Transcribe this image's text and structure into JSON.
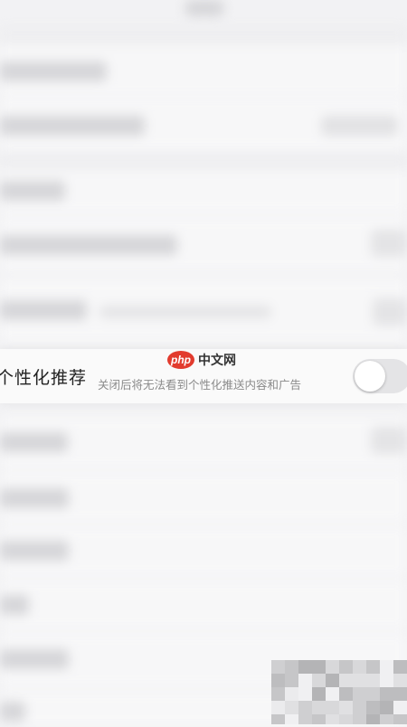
{
  "header": {
    "title_blurred": true
  },
  "personalization_row": {
    "title": "个性化推荐",
    "subtitle": "关闭后将无法看到个性化推送内容和广告",
    "toggle_on": false
  },
  "watermark": {
    "badge": "php",
    "text": "中文网"
  },
  "colors": {
    "background": "#f2f2f4",
    "row": "#fafafa",
    "toggle_off": "#e4e4e6",
    "watermark_red": "#e23b2e"
  }
}
